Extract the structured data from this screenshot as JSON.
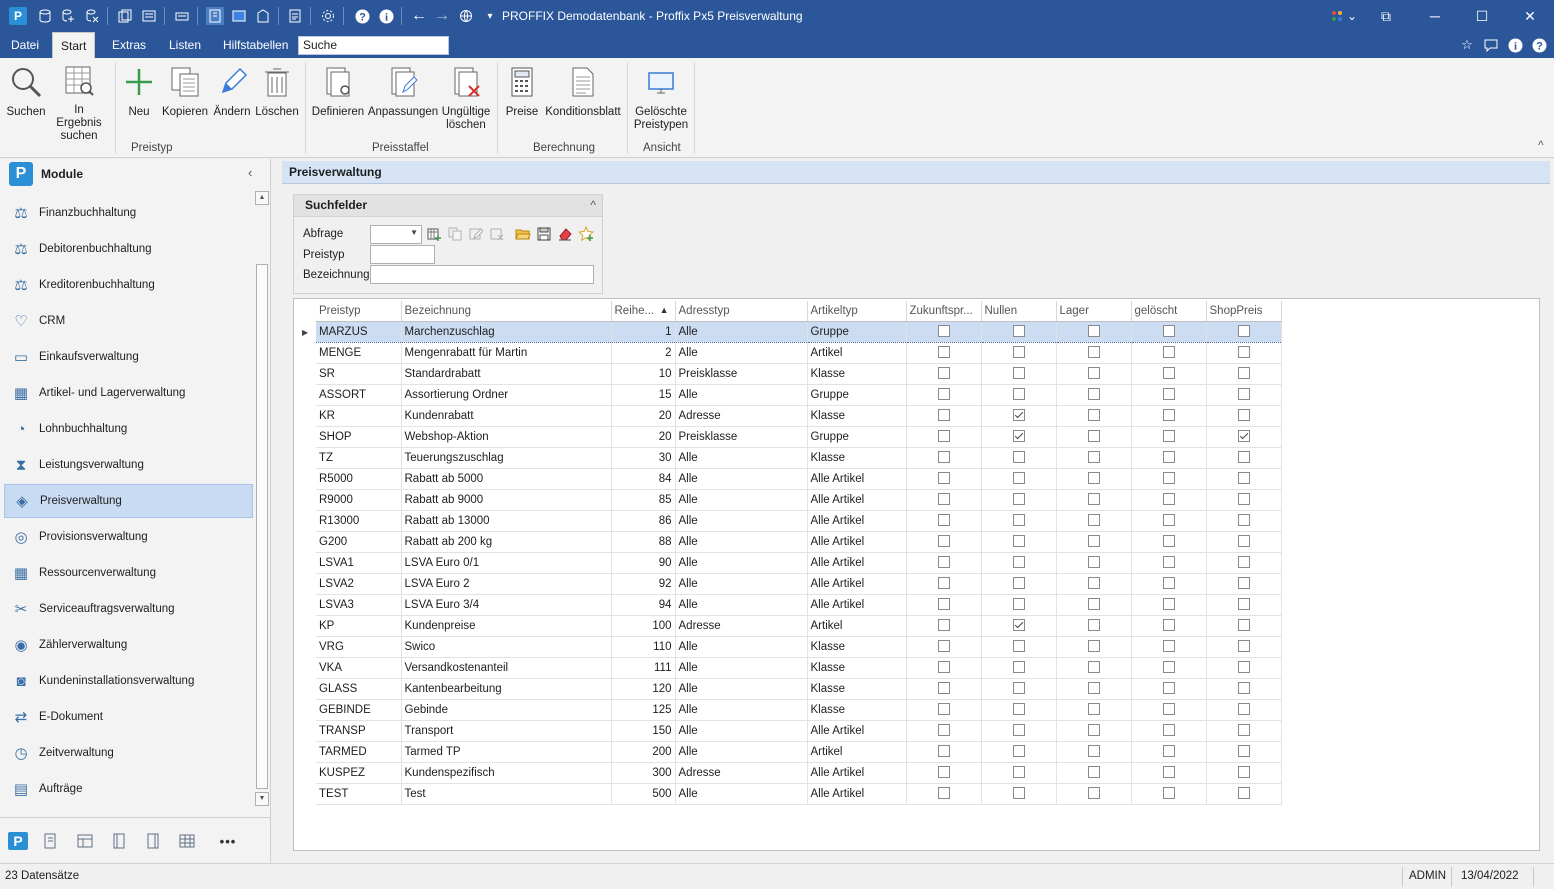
{
  "window": {
    "title": "PROFFIX Demodatenbank - Proffix Px5 Preisverwaltung",
    "minimize": "─",
    "maximize": "☐",
    "close": "✕",
    "restore": "⧉",
    "dropdown": "⌄",
    "quick_access_toggle": "▾",
    "ribbon_collapse": "^"
  },
  "menu": {
    "tabs": [
      "Datei",
      "Start",
      "Extras",
      "Listen",
      "Hilfstabellen"
    ],
    "active": "Start",
    "search_placeholder": "Suche"
  },
  "ribbon": {
    "buttons": {
      "suchen": "Suchen",
      "in_ergebnis_1": "In Ergebnis",
      "in_ergebnis_2": "suchen",
      "neu": "Neu",
      "kopieren": "Kopieren",
      "aendern": "Ändern",
      "loeschen": "Löschen",
      "definieren": "Definieren",
      "anpassungen": "Anpassungen",
      "ungueltige_1": "Ungültige",
      "ungueltige_2": "löschen",
      "preise": "Preise",
      "konditionsblatt": "Konditionsblatt",
      "geloeschte_1": "Gelöschte",
      "geloeschte_2": "Preistypen"
    },
    "groups": {
      "preistyp": "Preistyp",
      "preisstaffel": "Preisstaffel",
      "berechnung": "Berechnung",
      "ansicht": "Ansicht"
    }
  },
  "sidebar": {
    "title": "Module",
    "collapse": "‹",
    "logo": "P",
    "more": "•••",
    "scroll_up": "▲",
    "scroll_down": "▼",
    "items": [
      {
        "label": "Finanzbuchhaltung",
        "icon": "⚖"
      },
      {
        "label": "Debitorenbuchhaltung",
        "icon": "⚖"
      },
      {
        "label": "Kreditorenbuchhaltung",
        "icon": "⚖"
      },
      {
        "label": "CRM",
        "icon": "♡"
      },
      {
        "label": "Einkaufsverwaltung",
        "icon": "▭"
      },
      {
        "label": "Artikel- und Lagerverwaltung",
        "icon": "▦"
      },
      {
        "label": "Lohnbuchhaltung",
        "icon": "◔"
      },
      {
        "label": "Leistungsverwaltung",
        "icon": "⧗"
      },
      {
        "label": "Preisverwaltung",
        "icon": "◈"
      },
      {
        "label": "Provisionsverwaltung",
        "icon": "◎"
      },
      {
        "label": "Ressourcenverwaltung",
        "icon": "▦"
      },
      {
        "label": "Serviceauftragsverwaltung",
        "icon": "✂"
      },
      {
        "label": "Zählerverwaltung",
        "icon": "◉"
      },
      {
        "label": "Kundeninstallationsverwaltung",
        "icon": "◙"
      },
      {
        "label": "E-Dokument",
        "icon": "⇄"
      },
      {
        "label": "Zeitverwaltung",
        "icon": "◷"
      },
      {
        "label": "Aufträge",
        "icon": "▤"
      }
    ],
    "active_index": 8
  },
  "main": {
    "title": "Preisverwaltung",
    "search_panel": {
      "title": "Suchfelder",
      "collapse": "^",
      "abfrage_label": "Abfrage",
      "preistyp_label": "Preistyp",
      "bezeichnung_label": "Bezeichnung",
      "abfrage_value": "",
      "preistyp_value": "",
      "bezeichnung_value": ""
    },
    "grid": {
      "columns": [
        "Preistyp",
        "Bezeichnung",
        "Reihe...",
        "Adresstyp",
        "Artikeltyp",
        "Zukunftspr...",
        "Nullen",
        "Lager",
        "gelöscht",
        "ShopPreis"
      ],
      "sort_indicator": "▲",
      "row_indicator": "▶",
      "rows": [
        {
          "preistyp": "MARZUS",
          "bezeichnung": "Marchenzuschlag",
          "reihe": "1",
          "adresstyp": "Alle",
          "artikeltyp": "Gruppe",
          "zukunft": false,
          "nullen": false,
          "lager": false,
          "geloescht": false,
          "shop": false
        },
        {
          "preistyp": "MENGE",
          "bezeichnung": "Mengenrabatt für Martin",
          "reihe": "2",
          "adresstyp": "Alle",
          "artikeltyp": "Artikel",
          "zukunft": false,
          "nullen": false,
          "lager": false,
          "geloescht": false,
          "shop": false
        },
        {
          "preistyp": "SR",
          "bezeichnung": "Standardrabatt",
          "reihe": "10",
          "adresstyp": "Preisklasse",
          "artikeltyp": "Klasse",
          "zukunft": false,
          "nullen": false,
          "lager": false,
          "geloescht": false,
          "shop": false
        },
        {
          "preistyp": "ASSORT",
          "bezeichnung": "Assortierung Ordner",
          "reihe": "15",
          "adresstyp": "Alle",
          "artikeltyp": "Gruppe",
          "zukunft": false,
          "nullen": false,
          "lager": false,
          "geloescht": false,
          "shop": false
        },
        {
          "preistyp": "KR",
          "bezeichnung": "Kundenrabatt",
          "reihe": "20",
          "adresstyp": "Adresse",
          "artikeltyp": "Klasse",
          "zukunft": false,
          "nullen": true,
          "lager": false,
          "geloescht": false,
          "shop": false
        },
        {
          "preistyp": "SHOP",
          "bezeichnung": "Webshop-Aktion",
          "reihe": "20",
          "adresstyp": "Preisklasse",
          "artikeltyp": "Gruppe",
          "zukunft": false,
          "nullen": true,
          "lager": false,
          "geloescht": false,
          "shop": true
        },
        {
          "preistyp": "TZ",
          "bezeichnung": "Teuerungszuschlag",
          "reihe": "30",
          "adresstyp": "Alle",
          "artikeltyp": "Klasse",
          "zukunft": false,
          "nullen": false,
          "lager": false,
          "geloescht": false,
          "shop": false
        },
        {
          "preistyp": "R5000",
          "bezeichnung": "Rabatt ab 5000",
          "reihe": "84",
          "adresstyp": "Alle",
          "artikeltyp": "Alle Artikel",
          "zukunft": false,
          "nullen": false,
          "lager": false,
          "geloescht": false,
          "shop": false
        },
        {
          "preistyp": "R9000",
          "bezeichnung": "Rabatt ab 9000",
          "reihe": "85",
          "adresstyp": "Alle",
          "artikeltyp": "Alle Artikel",
          "zukunft": false,
          "nullen": false,
          "lager": false,
          "geloescht": false,
          "shop": false
        },
        {
          "preistyp": "R13000",
          "bezeichnung": "Rabatt ab 13000",
          "reihe": "86",
          "adresstyp": "Alle",
          "artikeltyp": "Alle Artikel",
          "zukunft": false,
          "nullen": false,
          "lager": false,
          "geloescht": false,
          "shop": false
        },
        {
          "preistyp": "G200",
          "bezeichnung": "Rabatt ab 200 kg",
          "reihe": "88",
          "adresstyp": "Alle",
          "artikeltyp": "Alle Artikel",
          "zukunft": false,
          "nullen": false,
          "lager": false,
          "geloescht": false,
          "shop": false
        },
        {
          "preistyp": "LSVA1",
          "bezeichnung": "LSVA Euro 0/1",
          "reihe": "90",
          "adresstyp": "Alle",
          "artikeltyp": "Alle Artikel",
          "zukunft": false,
          "nullen": false,
          "lager": false,
          "geloescht": false,
          "shop": false
        },
        {
          "preistyp": "LSVA2",
          "bezeichnung": "LSVA Euro 2",
          "reihe": "92",
          "adresstyp": "Alle",
          "artikeltyp": "Alle Artikel",
          "zukunft": false,
          "nullen": false,
          "lager": false,
          "geloescht": false,
          "shop": false
        },
        {
          "preistyp": "LSVA3",
          "bezeichnung": "LSVA Euro 3/4",
          "reihe": "94",
          "adresstyp": "Alle",
          "artikeltyp": "Alle Artikel",
          "zukunft": false,
          "nullen": false,
          "lager": false,
          "geloescht": false,
          "shop": false
        },
        {
          "preistyp": "KP",
          "bezeichnung": "Kundenpreise",
          "reihe": "100",
          "adresstyp": "Adresse",
          "artikeltyp": "Artikel",
          "zukunft": false,
          "nullen": true,
          "lager": false,
          "geloescht": false,
          "shop": false
        },
        {
          "preistyp": "VRG",
          "bezeichnung": "Swico",
          "reihe": "110",
          "adresstyp": "Alle",
          "artikeltyp": "Klasse",
          "zukunft": false,
          "nullen": false,
          "lager": false,
          "geloescht": false,
          "shop": false
        },
        {
          "preistyp": "VKA",
          "bezeichnung": "Versandkostenanteil",
          "reihe": "111",
          "adresstyp": "Alle",
          "artikeltyp": "Klasse",
          "zukunft": false,
          "nullen": false,
          "lager": false,
          "geloescht": false,
          "shop": false
        },
        {
          "preistyp": "GLASS",
          "bezeichnung": "Kantenbearbeitung",
          "reihe": "120",
          "adresstyp": "Alle",
          "artikeltyp": "Klasse",
          "zukunft": false,
          "nullen": false,
          "lager": false,
          "geloescht": false,
          "shop": false
        },
        {
          "preistyp": "GEBINDE",
          "bezeichnung": "Gebinde",
          "reihe": "125",
          "adresstyp": "Alle",
          "artikeltyp": "Klasse",
          "zukunft": false,
          "nullen": false,
          "lager": false,
          "geloescht": false,
          "shop": false
        },
        {
          "preistyp": "TRANSP",
          "bezeichnung": "Transport",
          "reihe": "150",
          "adresstyp": "Alle",
          "artikeltyp": "Alle Artikel",
          "zukunft": false,
          "nullen": false,
          "lager": false,
          "geloescht": false,
          "shop": false
        },
        {
          "preistyp": "TARMED",
          "bezeichnung": "Tarmed TP",
          "reihe": "200",
          "adresstyp": "Alle",
          "artikeltyp": "Artikel",
          "zukunft": false,
          "nullen": false,
          "lager": false,
          "geloescht": false,
          "shop": false
        },
        {
          "preistyp": "KUSPEZ",
          "bezeichnung": "Kundenspezifisch",
          "reihe": "300",
          "adresstyp": "Adresse",
          "artikeltyp": "Alle Artikel",
          "zukunft": false,
          "nullen": false,
          "lager": false,
          "geloescht": false,
          "shop": false
        },
        {
          "preistyp": "TEST",
          "bezeichnung": "Test",
          "reihe": "500",
          "adresstyp": "Alle",
          "artikeltyp": "Alle Artikel",
          "zukunft": false,
          "nullen": false,
          "lager": false,
          "geloescht": false,
          "shop": false
        }
      ]
    }
  },
  "status": {
    "records": "23 Datensätze",
    "user": "ADMIN",
    "date": "13/04/2022"
  },
  "colors": {
    "titlebar": "#2b579a",
    "selection": "#cbdcf3",
    "accent": "#2b8fd6"
  }
}
